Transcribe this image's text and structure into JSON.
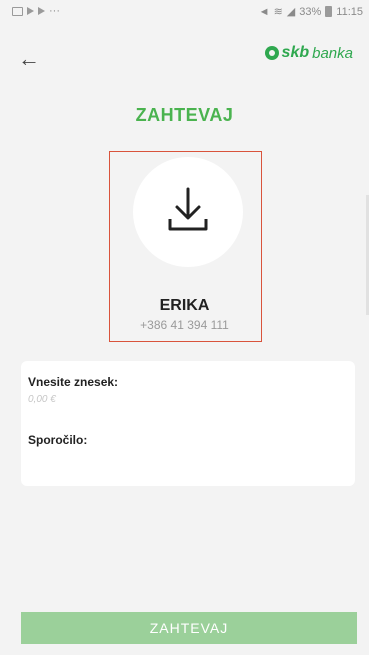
{
  "status": {
    "time": "11:15",
    "battery": "33%"
  },
  "header": {
    "logo_skb": "skb",
    "logo_banka": "banka"
  },
  "title": "ZAHTEVAJ",
  "contact": {
    "name": "ERIKA",
    "phone": "+386 41 394 111"
  },
  "form": {
    "amount_label": "Vnesite znesek:",
    "amount_placeholder": "0,00 €",
    "message_label": "Sporočilo:"
  },
  "submit_label": "ZAHTEVAJ",
  "colors": {
    "accent": "#4ab34f",
    "button": "#9bd09a",
    "highlight": "#d9533b"
  }
}
